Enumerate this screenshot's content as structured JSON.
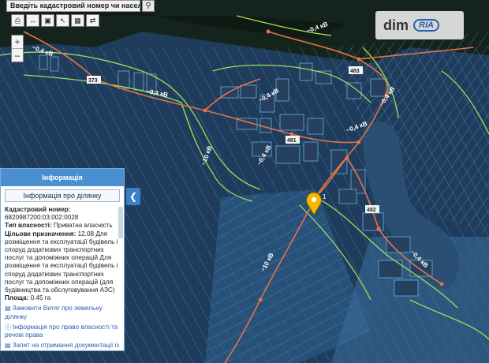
{
  "search": {
    "placeholder": "Введіть кадастровий номер чи населений"
  },
  "watermark": {
    "dim": "dim",
    "ria": "RIA"
  },
  "map": {
    "road_labels": [
      "~0,4 кВ",
      "~0,4 кВ",
      "~0,4 кВ",
      "~0,4 кВ",
      "~0,4 кВ",
      "~0,4 кВ",
      "~0,4 кВ",
      "~0,4 кВ",
      "~10 кВ",
      "~10 кВ"
    ],
    "pole_labels": [
      "373",
      "483",
      "482",
      "481"
    ],
    "marker_label": "1"
  },
  "panel": {
    "header": "Інформація",
    "subtitle": "Інформація про ділянку",
    "cadastral_label": "Кадастровий номер:",
    "cadastral_value": "6820987200:03:002:0028",
    "ownership_label": "Тип власності:",
    "ownership_value": "Приватна власність",
    "purpose_label": "Цільове призначення:",
    "purpose_value": "12.08 Для розміщення та експлуатації будівель і споруд додаткових транспортних послуг та допоміжних операцій Для розміщення та експлуатації будівель і споруд додаткових транспортних послуг та допоміжних операцій (для будівництва та обслуговування АЗС)",
    "area_label": "Площа:",
    "area_value": "0.45 га",
    "link1": "Замовити Витяг про земельну ділянку",
    "link2": "Інформація про право власності та речові права",
    "link3": "Запит на отримання документації із землеустрою"
  },
  "colors": {
    "parcel": "#5fb3e6",
    "boundary": "#9ee05a",
    "powerline": "#e2734a",
    "marker": "#f5b800",
    "panel_head": "#4b8fd3"
  }
}
